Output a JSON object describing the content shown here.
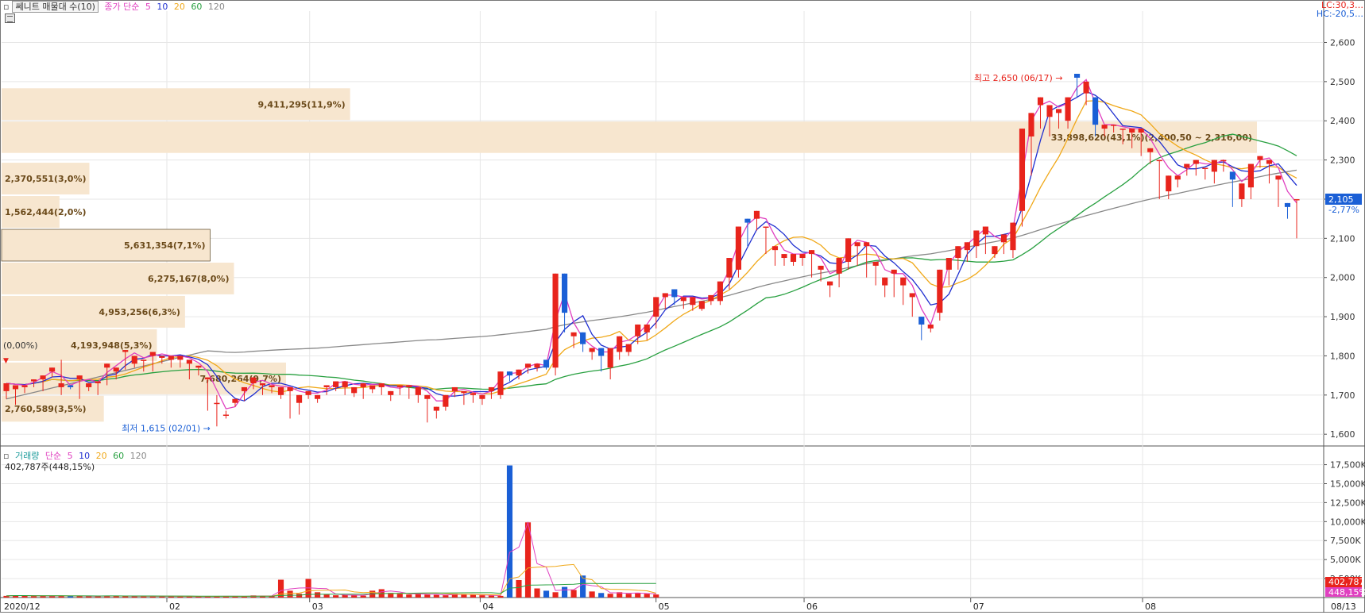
{
  "colors": {
    "up": "#e8241c",
    "down": "#1a5fd6",
    "ma5": "#e040c0",
    "ma10": "#1f2fd0",
    "ma20": "#f0a818",
    "ma60": "#28a040",
    "ma120": "#888888",
    "profile": "#f7e6cf",
    "profile_text": "#6b4a1a",
    "grid": "#e6e6e6"
  },
  "header": {
    "title_button": "쎄니트 매물대 수(10)",
    "ma_label": "종가 단순",
    "ma_periods": [
      "5",
      "10",
      "20",
      "60",
      "120"
    ],
    "corner_top": "LC:30,3…",
    "corner_bottom": "HC:-20,5…"
  },
  "volume_header": {
    "title": "거래량",
    "ma_label": "단순",
    "ma_periods": [
      "5",
      "10",
      "20",
      "60",
      "120"
    ],
    "last_value_text": "402,787주(448,15%)"
  },
  "chart_data": [
    {
      "type": "candlestick",
      "x_labels": [
        "2020/12",
        "02",
        "03",
        "04",
        "05",
        "06",
        "07",
        "08",
        "08/13"
      ],
      "yticks": [
        "1,600",
        "1,700",
        "1,800",
        "1,900",
        "2,000",
        "2,100",
        "2,200",
        "2,300",
        "2,400",
        "2,500",
        "2,600"
      ],
      "ylim": [
        1570,
        2680
      ],
      "high_annotation": "최고 2,650 (06/17)",
      "low_annotation": "최저 1,615 (02/01)",
      "last_price": "2,105",
      "last_change": "-2,77%",
      "start_label": "(0,00%)",
      "ohlc": [
        [
          1710,
          1710,
          1730,
          1690,
          1715,
          1675,
          1725,
          1705,
          1730,
          1715
        ],
        [
          1720,
          1715,
          1725,
          1705,
          1735,
          1720,
          1740,
          1730,
          1750,
          1735
        ],
        [
          1740,
          1735,
          1750,
          1710,
          1760,
          1745,
          1770,
          1755,
          1810,
          1770
        ],
        [
          1720,
          1790,
          1730,
          1700,
          1725,
          1720,
          1720,
          1715,
          1740,
          1722
        ],
        [
          1740,
          1700,
          1750,
          1690,
          1720,
          1710,
          1730,
          1715,
          1740,
          1725
        ],
        [
          1730,
          1710,
          1735,
          1700,
          1770,
          1725,
          1780,
          1740,
          1780,
          1745
        ],
        [
          1760,
          1745,
          1770,
          1740,
          1810,
          1765,
          1815,
          1790,
          1815,
          1800
        ],
        [
          1780,
          1790,
          1800,
          1770,
          1790,
          1790,
          1790,
          1760,
          1800,
          1770
        ],
        [
          1800,
          1770,
          1810,
          1760,
          1795,
          1790,
          1800,
          1780,
          1805,
          1790
        ],
        [
          1790,
          1780,
          1800,
          1770,
          1790,
          1795,
          1800,
          1770,
          1810,
          1780
        ],
        [
          1780,
          1760,
          1790,
          1740,
          1770,
          1760,
          1775,
          1750,
          1810,
          1760
        ],
        [
          1740,
          1720,
          1745,
          1660,
          1680,
          1700,
          1680,
          1620,
          1700,
          1615
        ],
        [
          1650,
          1660,
          1650,
          1640,
          1680,
          1670,
          1690,
          1680,
          1700,
          1690
        ],
        [
          1710,
          1685,
          1720,
          1700,
          1730,
          1715,
          1745,
          1715,
          1740,
          1720
        ],
        [
          1725,
          1710,
          1730,
          1700,
          1720,
          1715,
          1725,
          1705,
          1735,
          1720
        ],
        [
          1700,
          1700,
          1720,
          1690,
          1710,
          1700,
          1720,
          1640,
          1720,
          1640
        ],
        [
          1680,
          1650,
          1700,
          1680,
          1700,
          1690,
          1710,
          1690,
          1700,
          1695
        ],
        [
          1690,
          1685,
          1700,
          1680,
          1720,
          1700,
          1725,
          1710,
          1740,
          1715
        ],
        [
          1720,
          1710,
          1735,
          1715,
          1720,
          1710,
          1735,
          1700,
          1725,
          1710
        ],
        [
          1705,
          1695,
          1720,
          1700,
          1720,
          1705,
          1730,
          1690,
          1710,
          1700
        ],
        [
          1715,
          1705,
          1725,
          1710,
          1720,
          1710,
          1730,
          1700,
          1720,
          1705
        ],
        [
          1700,
          1690,
          1710,
          1685,
          1720,
          1705,
          1725,
          1700,
          1720,
          1710
        ],
        [
          1720,
          1705,
          1725,
          1690,
          1700,
          1690,
          1720,
          1680,
          1720,
          1690
        ],
        [
          1690,
          1635,
          1700,
          1630,
          1660,
          1650,
          1670,
          1640,
          1690,
          1660
        ],
        [
          1670,
          1660,
          1700,
          1660,
          1710,
          1700,
          1720,
          1695,
          1720,
          1705
        ],
        [
          1705,
          1700,
          1710,
          1675,
          1700,
          1690,
          1705,
          1680,
          1710,
          1690
        ],
        [
          1690,
          1680,
          1700,
          1675,
          1710,
          1700,
          1720,
          1690,
          1720,
          1700
        ],
        [
          1700,
          1690,
          1760,
          1700,
          1760,
          1740,
          1750,
          1735,
          1760,
          1750
        ],
        [
          1750,
          1740,
          1765,
          1740,
          1770,
          1755,
          1780,
          1765,
          1780,
          1770
        ],
        [
          1770,
          1760,
          1780,
          1765,
          1790,
          1775,
          1770,
          1765,
          1790,
          1775
        ],
        [
          1770,
          1750,
          2010,
          1760,
          2010,
          1910,
          1910,
          1860,
          1900,
          1870
        ],
        [
          1850,
          1830,
          1860,
          1820,
          1860,
          1830,
          1830,
          1810,
          1830,
          1800
        ],
        [
          1810,
          1790,
          1820,
          1800,
          1820,
          1805,
          1800,
          1760,
          1810,
          1765
        ],
        [
          1770,
          1740,
          1820,
          1760,
          1810,
          1800,
          1850,
          1790,
          1880,
          1820
        ],
        [
          1810,
          1800,
          1830,
          1815,
          1850,
          1830,
          1880,
          1840,
          1880,
          1850
        ],
        [
          1860,
          1840,
          1880,
          1855,
          1900,
          1870,
          1950,
          1890,
          1960,
          1930
        ],
        [
          1950,
          1920,
          1960,
          1940,
          1970,
          1940,
          1950,
          1930,
          1960,
          1935
        ],
        [
          1940,
          1930,
          1950,
          1920,
          1930,
          1915,
          1950,
          1920,
          1940,
          1925
        ],
        [
          1920,
          1915,
          1940,
          1920,
          1940,
          1930,
          1955,
          1935,
          1960,
          1945
        ],
        [
          1940,
          1930,
          1990,
          1950,
          2000,
          1970,
          2050,
          1980,
          2060,
          2020
        ],
        [
          2020,
          2000,
          2130,
          2050,
          2150,
          2110,
          2140,
          2080,
          2160,
          2100
        ],
        [
          2150,
          2120,
          2170,
          2130,
          2130,
          2110,
          2130,
          2060,
          2140,
          2080
        ],
        [
          2070,
          2040,
          2080,
          2030,
          2050,
          2030,
          2060,
          2040,
          2060,
          2045
        ],
        [
          2040,
          2030,
          2060,
          2040,
          2050,
          2030,
          2060,
          2040,
          2070,
          2050
        ],
        [
          2060,
          2050,
          2070,
          2000,
          2020,
          2000,
          2030,
          1990,
          2030,
          1980
        ],
        [
          1980,
          1950,
          1990,
          1970,
          2010,
          1975,
          2050,
          2000,
          2060,
          2030
        ],
        [
          2040,
          2020,
          2100,
          2050,
          2080,
          2050,
          2090,
          2030,
          2090,
          2040
        ],
        [
          2080,
          2040,
          2090,
          2000,
          2030,
          2000,
          2040,
          1980,
          2030,
          1990
        ],
        [
          1980,
          1950,
          2000,
          1960,
          2010,
          1980,
          2020,
          1950,
          1990,
          1960
        ],
        [
          1980,
          1960,
          2000,
          1930,
          1950,
          1920,
          1960,
          1900,
          1950,
          1920
        ],
        [
          1900,
          1870,
          1880,
          1840,
          1870,
          1860,
          1880,
          1860,
          1960,
          1870
        ],
        [
          1910,
          1890,
          2020,
          1900,
          2020,
          1980,
          2050,
          2000,
          2070,
          2040
        ],
        [
          2050,
          2020,
          2080,
          2040,
          2070,
          2040,
          2090,
          2040,
          2080,
          2050
        ],
        [
          2080,
          2050,
          2120,
          2070,
          2110,
          2080,
          2130,
          2060,
          2100,
          2070
        ],
        [
          2060,
          2050,
          2080,
          2060,
          2090,
          2060,
          2110,
          2070,
          2090,
          2075
        ],
        [
          2070,
          2050,
          2140,
          2070,
          2170,
          2130,
          2380,
          2150,
          2640,
          2360
        ],
        [
          2360,
          2320,
          2420,
          2260,
          2440,
          2380,
          2460,
          2390,
          2470,
          2400
        ],
        [
          2410,
          2380,
          2440,
          2360,
          2420,
          2400,
          2430,
          2380,
          2440,
          2400
        ],
        [
          2400,
          2380,
          2460,
          2420,
          2520,
          2460,
          2510,
          2460,
          2620,
          2470
        ],
        [
          2470,
          2440,
          2500,
          2450,
          2460,
          2380,
          2390,
          2360,
          2400,
          2380
        ],
        [
          2380,
          2370,
          2390,
          2360,
          2390,
          2370,
          2390,
          2380,
          2400,
          2385
        ],
        [
          2380,
          2370,
          2380,
          2340,
          2370,
          2330,
          2380,
          2360,
          2380,
          2370
        ],
        [
          2370,
          2360,
          2380,
          2310,
          2320,
          2300,
          2330,
          2290,
          2330,
          2300
        ],
        [
          2300,
          2270,
          2300,
          2200,
          2220,
          2200,
          2260,
          2210,
          2270,
          2240
        ],
        [
          2250,
          2240,
          2260,
          2230,
          2280,
          2260,
          2290,
          2270,
          2300,
          2280
        ],
        [
          2290,
          2270,
          2300,
          2260,
          2280,
          2250,
          2280,
          2260,
          2280,
          2265
        ],
        [
          2270,
          2240,
          2300,
          2260,
          2300,
          2270,
          2300,
          2280,
          2290,
          2270
        ],
        [
          2270,
          2230,
          2250,
          2180,
          2200,
          2180,
          2240,
          2200,
          2260,
          2220
        ],
        [
          2230,
          2200,
          2290,
          2240,
          2300,
          2280,
          2310,
          2290,
          2320,
          2300
        ],
        [
          2290,
          2270,
          2300,
          2240,
          2250,
          2230,
          2260,
          2180,
          2210,
          2190
        ],
        [
          2190,
          2150,
          2180,
          2160,
          2200,
          2180,
          2200,
          2100,
          2160,
          2105
        ]
      ],
      "ma_lines_note": "moving averages of close",
      "volume_profile": [
        {
          "label": "7,680,264(9,7%)",
          "value": 7680264,
          "low": 1700,
          "high": 1785
        },
        {
          "label": "2,760,589(3,5%)",
          "value": 2760589,
          "low": 1630,
          "high": 1700
        },
        {
          "label": "4,193,948(5,3%)",
          "value": 4193948,
          "low": 1785,
          "high": 1870
        },
        {
          "label": "4,953,256(6,3%)",
          "value": 4953256,
          "low": 1870,
          "high": 1955
        },
        {
          "label": "6,275,167(8,0%)",
          "value": 6275167,
          "low": 1955,
          "high": 2040
        },
        {
          "label": "5,631,354(7,1%)",
          "value": 5631354,
          "low": 2040,
          "high": 2125
        },
        {
          "label": "1,562,444(2,0%)",
          "value": 1562444,
          "low": 2125,
          "high": 2210
        },
        {
          "label": "2,370,551(3,0%)",
          "value": 2370551,
          "low": 2210,
          "high": 2295
        },
        {
          "label": "33,898,620(43,1%)(2,400,50 ~ 2,316,00)",
          "value": 33898620,
          "low": 2316,
          "high": 2400
        },
        {
          "label": "9,411,295(11,9%)",
          "value": 9411295,
          "low": 2400,
          "high": 2485
        }
      ]
    },
    {
      "type": "bar",
      "title": "거래량",
      "yticks": [
        "2,500K",
        "5,000K",
        "7,500K",
        "10,000K",
        "12,500K",
        "15,000K",
        "17,500K"
      ],
      "ylim": [
        0,
        18500
      ],
      "last_value": "402,787",
      "last_pct": "448,15%",
      "values_k": [
        220,
        300,
        260,
        180,
        200,
        210,
        230,
        190,
        200,
        180,
        170,
        260,
        200,
        180,
        170,
        170,
        150,
        180,
        160,
        150,
        150,
        140,
        150,
        180,
        160,
        150,
        150,
        280,
        200,
        180,
        2350,
        900,
        500,
        2450,
        700,
        400,
        300,
        350,
        300,
        250,
        900,
        1100,
        600,
        500,
        400,
        500,
        400,
        350,
        300,
        500,
        450,
        350,
        300,
        250,
        220,
        17400,
        2300,
        9900,
        1200,
        900,
        700,
        1400,
        1000,
        2900,
        800,
        600,
        500,
        700,
        500,
        600,
        500,
        400
      ]
    }
  ]
}
